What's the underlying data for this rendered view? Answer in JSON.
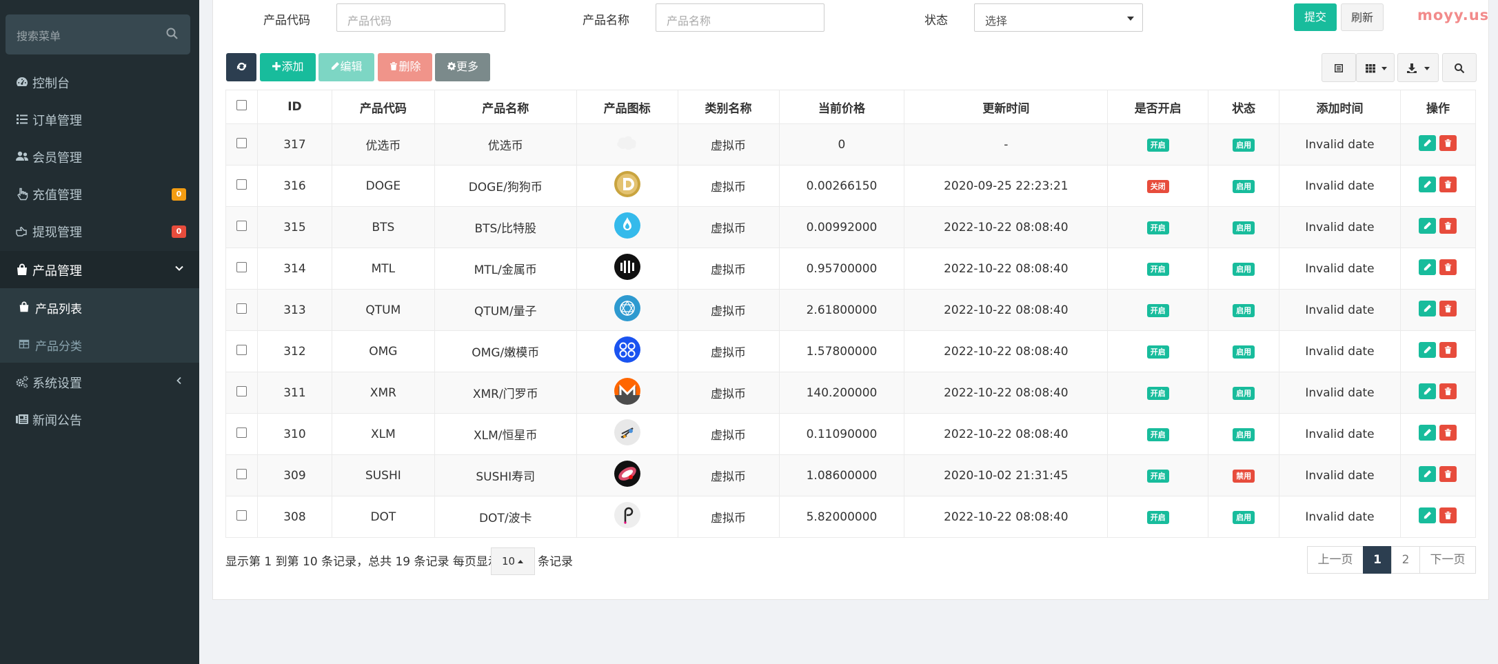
{
  "sidebar": {
    "search_placeholder": "搜索菜单",
    "items": [
      {
        "label": "控制台",
        "icon": "dashboard-icon"
      },
      {
        "label": "订单管理",
        "icon": "list-icon"
      },
      {
        "label": "会员管理",
        "icon": "users-icon"
      },
      {
        "label": "充值管理",
        "icon": "hand-pointer-icon",
        "badge": "0",
        "badge_color": "#f39c12"
      },
      {
        "label": "提现管理",
        "icon": "hand-icon",
        "badge": "0",
        "badge_color": "#e74c3c"
      },
      {
        "label": "产品管理",
        "icon": "shopping-bag-icon"
      },
      {
        "label": "系统设置",
        "icon": "cogs-icon"
      },
      {
        "label": "新闻公告",
        "icon": "newspaper-icon"
      }
    ],
    "submenu": [
      {
        "label": "产品列表",
        "icon": "shopping-bag-icon",
        "active": true
      },
      {
        "label": "产品分类",
        "icon": "table-icon",
        "active": false
      }
    ]
  },
  "filter": {
    "code_label": "产品代码",
    "code_placeholder": "产品代码",
    "name_label": "产品名称",
    "name_placeholder": "产品名称",
    "status_label": "状态",
    "status_value": "选择",
    "submit": "提交",
    "refresh": "刷新"
  },
  "watermark": "moyy.us",
  "toolbar": {
    "add": "添加",
    "edit": "编辑",
    "delete": "删除",
    "more": "更多"
  },
  "table": {
    "headers": [
      "ID",
      "产品代码",
      "产品名称",
      "产品图标",
      "类别名称",
      "当前价格",
      "更新时间",
      "是否开启",
      "状态",
      "添加时间",
      "操作"
    ],
    "rows": [
      {
        "id": "317",
        "code": "优选币",
        "name": "优选币",
        "category": "虚拟币",
        "price": "0",
        "updated": "-",
        "open": "开启",
        "open_color": "#18bc9c",
        "status": "启用",
        "status_color": "#18bc9c",
        "added": "Invalid date",
        "icon": "blank-coin-icon"
      },
      {
        "id": "316",
        "code": "DOGE",
        "name": "DOGE/狗狗币",
        "category": "虚拟币",
        "price": "0.00266150",
        "updated": "2020-09-25 22:23:21",
        "open": "关闭",
        "open_color": "#e74c3c",
        "status": "启用",
        "status_color": "#18bc9c",
        "added": "Invalid date",
        "icon": "doge-coin-icon"
      },
      {
        "id": "315",
        "code": "BTS",
        "name": "BTS/比特股",
        "category": "虚拟币",
        "price": "0.00992000",
        "updated": "2022-10-22 08:08:40",
        "open": "开启",
        "open_color": "#18bc9c",
        "status": "启用",
        "status_color": "#18bc9c",
        "added": "Invalid date",
        "icon": "bts-coin-icon"
      },
      {
        "id": "314",
        "code": "MTL",
        "name": "MTL/金属币",
        "category": "虚拟币",
        "price": "0.95700000",
        "updated": "2022-10-22 08:08:40",
        "open": "开启",
        "open_color": "#18bc9c",
        "status": "启用",
        "status_color": "#18bc9c",
        "added": "Invalid date",
        "icon": "mtl-coin-icon"
      },
      {
        "id": "313",
        "code": "QTUM",
        "name": "QTUM/量子",
        "category": "虚拟币",
        "price": "2.61800000",
        "updated": "2022-10-22 08:08:40",
        "open": "开启",
        "open_color": "#18bc9c",
        "status": "启用",
        "status_color": "#18bc9c",
        "added": "Invalid date",
        "icon": "qtum-coin-icon"
      },
      {
        "id": "312",
        "code": "OMG",
        "name": "OMG/嫩模币",
        "category": "虚拟币",
        "price": "1.57800000",
        "updated": "2022-10-22 08:08:40",
        "open": "开启",
        "open_color": "#18bc9c",
        "status": "启用",
        "status_color": "#18bc9c",
        "added": "Invalid date",
        "icon": "omg-coin-icon"
      },
      {
        "id": "311",
        "code": "XMR",
        "name": "XMR/门罗币",
        "category": "虚拟币",
        "price": "140.200000",
        "updated": "2022-10-22 08:08:40",
        "open": "开启",
        "open_color": "#18bc9c",
        "status": "启用",
        "status_color": "#18bc9c",
        "added": "Invalid date",
        "icon": "xmr-coin-icon"
      },
      {
        "id": "310",
        "code": "XLM",
        "name": "XLM/恒星币",
        "category": "虚拟币",
        "price": "0.11090000",
        "updated": "2022-10-22 08:08:40",
        "open": "开启",
        "open_color": "#18bc9c",
        "status": "启用",
        "status_color": "#18bc9c",
        "added": "Invalid date",
        "icon": "xlm-coin-icon"
      },
      {
        "id": "309",
        "code": "SUSHI",
        "name": "SUSHI寿司",
        "category": "虚拟币",
        "price": "1.08600000",
        "updated": "2020-10-02 21:31:45",
        "open": "开启",
        "open_color": "#18bc9c",
        "status": "禁用",
        "status_color": "#e74c3c",
        "added": "Invalid date",
        "icon": "sushi-coin-icon"
      },
      {
        "id": "308",
        "code": "DOT",
        "name": "DOT/波卡",
        "category": "虚拟币",
        "price": "5.82000000",
        "updated": "2022-10-22 08:08:40",
        "open": "开启",
        "open_color": "#18bc9c",
        "status": "启用",
        "status_color": "#18bc9c",
        "added": "Invalid date",
        "icon": "dot-coin-icon"
      }
    ]
  },
  "pagination": {
    "summary": "显示第 1 到第 10 条记录，总共 19 条记录 每页显示",
    "per_page": "10",
    "suffix": "条记录",
    "prev": "上一页",
    "pages": [
      "1",
      "2"
    ],
    "current": "1",
    "next": "下一页"
  },
  "colors": {
    "sidebar_bg": "#222d32",
    "primary_green": "#18bc9c",
    "danger_red": "#e74c3c",
    "dark_button": "#2c3e50",
    "warning_orange": "#f39c12"
  }
}
